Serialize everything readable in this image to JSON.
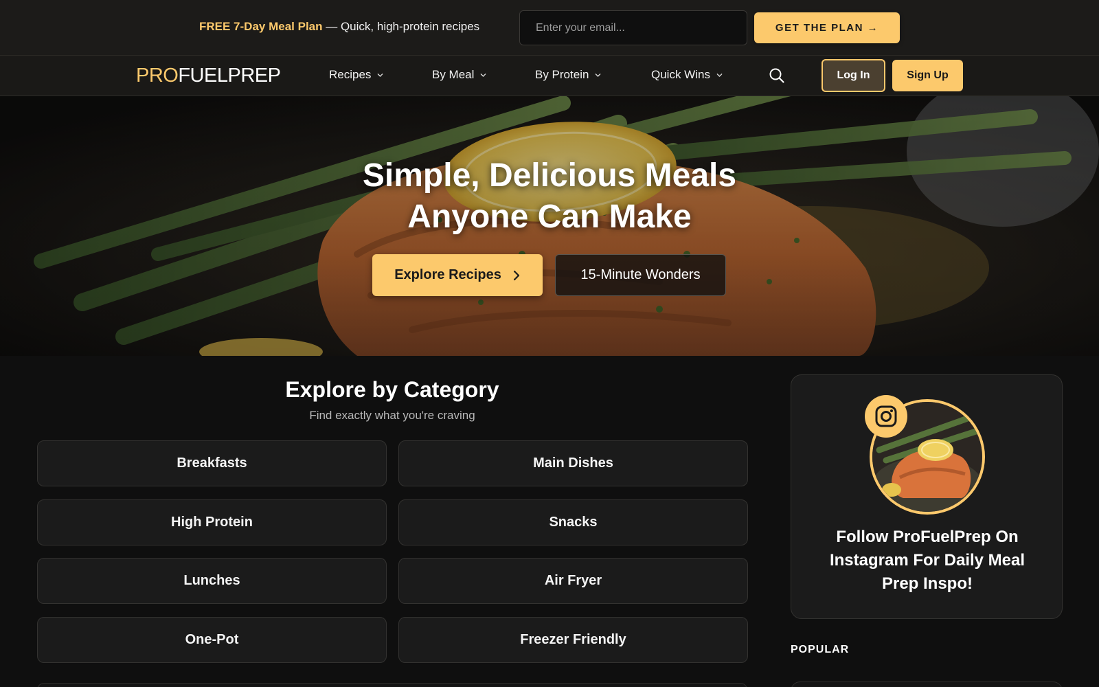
{
  "promo": {
    "highlight": "FREE 7-Day Meal Plan",
    "text": " — Quick, high-protein recipes",
    "email_placeholder": "Enter your email...",
    "cta_label": "GET THE PLAN →"
  },
  "nav": {
    "logo_accent": "PRO",
    "logo_rest": "FUELPREP",
    "items": [
      {
        "label": "Recipes"
      },
      {
        "label": "By Meal"
      },
      {
        "label": "By Protein"
      },
      {
        "label": "Quick Wins"
      }
    ],
    "login_label": "Log In",
    "signup_label": "Sign Up"
  },
  "hero": {
    "title_line1": "Simple, Delicious Meals",
    "title_line2": "Anyone Can Make",
    "primary_label": "Explore Recipes",
    "secondary_label": "15-Minute Wonders"
  },
  "categories": {
    "title": "Explore by Category",
    "subtitle": "Find exactly what you're craving",
    "items": [
      {
        "label": "Breakfasts"
      },
      {
        "label": "Main Dishes"
      },
      {
        "label": "High Protein"
      },
      {
        "label": "Snacks"
      },
      {
        "label": "Lunches"
      },
      {
        "label": "Air Fryer"
      },
      {
        "label": "One-Pot"
      },
      {
        "label": "Freezer Friendly"
      }
    ]
  },
  "sidebar": {
    "instagram_text": "Follow ProFuelPrep On Instagram For Daily Meal Prep Inspo!",
    "popular_heading": "POPULAR"
  },
  "theme": {
    "accent": "#fcc96c",
    "background": "#0f0f0f",
    "card": "#1b1b1b"
  },
  "icons": {
    "nav_search": "search-icon",
    "nav_chevron": "chevron-down-icon",
    "hero_arrow": "chevron-right-icon",
    "instagram": "instagram-icon"
  }
}
